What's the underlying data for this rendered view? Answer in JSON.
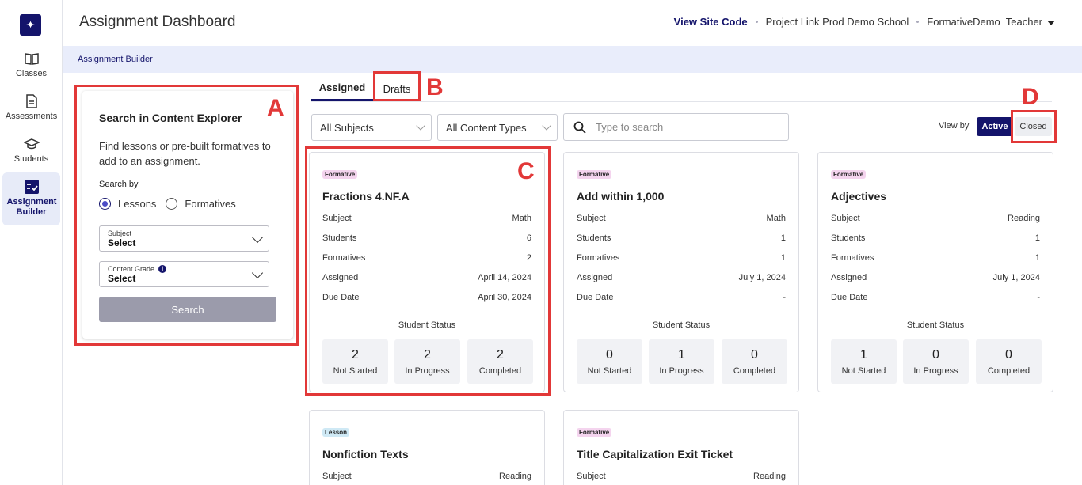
{
  "sidebar": {
    "items": [
      {
        "label": "Classes",
        "icon": "book-open-icon"
      },
      {
        "label": "Assessments",
        "icon": "document-icon"
      },
      {
        "label": "Students",
        "icon": "graduation-cap-icon"
      },
      {
        "label": "Assignment Builder",
        "icon": "checklist-icon",
        "active": true
      }
    ]
  },
  "header": {
    "title": "Assignment Dashboard",
    "site_code_link": "View Site Code",
    "school": "Project Link Prod Demo School",
    "user": "FormativeDemo",
    "role": "Teacher"
  },
  "breadcrumb": "Assignment Builder",
  "search_panel": {
    "title": "Search in Content Explorer",
    "description": "Find lessons or pre-built formatives to add to an assignment.",
    "search_by_label": "Search by",
    "options": [
      "Lessons",
      "Formatives"
    ],
    "selected_option": "Lessons",
    "subject_label": "Subject",
    "subject_value": "Select",
    "grade_label": "Content Grade",
    "grade_value": "Select",
    "search_button": "Search"
  },
  "tabs": {
    "assigned": "Assigned",
    "drafts": "Drafts"
  },
  "filters": {
    "subjects": "All Subjects",
    "content_types": "All Content Types",
    "search_placeholder": "Type to search",
    "view_by_label": "View by",
    "active_label": "Active",
    "closed_label": "Closed"
  },
  "field_labels": {
    "subject": "Subject",
    "students": "Students",
    "formatives": "Formatives",
    "assigned": "Assigned",
    "due_date": "Due Date",
    "student_status": "Student Status",
    "not_started": "Not Started",
    "in_progress": "In Progress",
    "completed": "Completed"
  },
  "cards": [
    {
      "type": "Formative",
      "title": "Fractions 4.NF.A",
      "subject": "Math",
      "students": "6",
      "formatives": "2",
      "assigned": "April 14, 2024",
      "due_date": "April 30, 2024",
      "not_started": "2",
      "in_progress": "2",
      "completed": "2"
    },
    {
      "type": "Formative",
      "title": "Add within 1,000",
      "subject": "Math",
      "students": "1",
      "formatives": "1",
      "assigned": "July 1, 2024",
      "due_date": "-",
      "not_started": "0",
      "in_progress": "1",
      "completed": "0"
    },
    {
      "type": "Formative",
      "title": "Adjectives",
      "subject": "Reading",
      "students": "1",
      "formatives": "1",
      "assigned": "July 1, 2024",
      "due_date": "-",
      "not_started": "1",
      "in_progress": "0",
      "completed": "0"
    },
    {
      "type": "Lesson",
      "title": "Nonfiction Texts",
      "subject": "Reading"
    },
    {
      "type": "Formative",
      "title": "Title Capitalization Exit Ticket",
      "subject": "Reading"
    }
  ],
  "annotations": {
    "a": "A",
    "b": "B",
    "c": "C",
    "d": "D",
    "color": "#e23838"
  }
}
